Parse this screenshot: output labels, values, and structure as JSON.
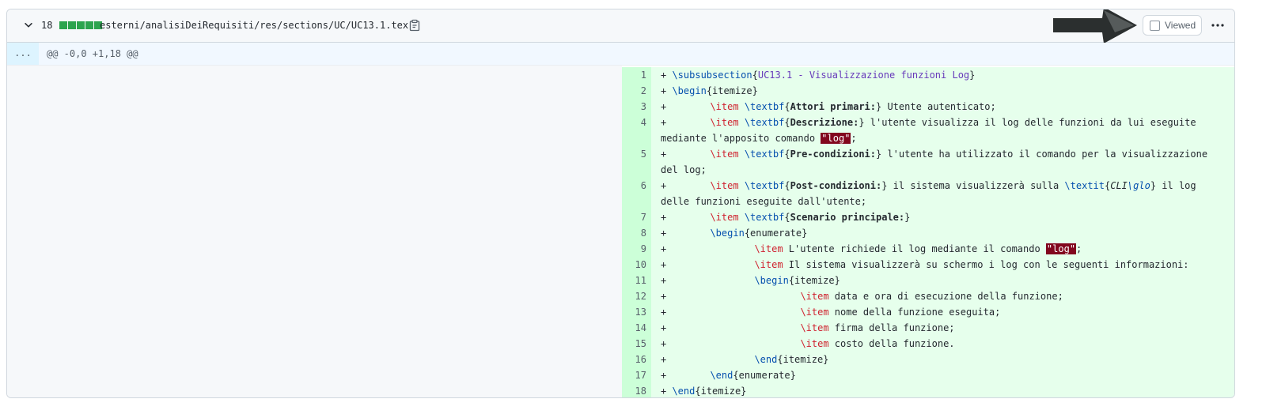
{
  "file": {
    "added_lines": "18",
    "diffstat_blocks": 5,
    "path": "esterni/analisiDeiRequisiti/res/sections/UC/UC13.1.tex",
    "viewed_label": "Viewed",
    "viewed_checked": false
  },
  "hunk": {
    "expander": "...",
    "header": "@@ -0,0 +1,18 @@"
  },
  "colors": {
    "addition_bg": "#e6ffec",
    "addition_num_bg": "#ccffd8",
    "diffstat_green": "#2da44e",
    "command_blue": "#0550ae",
    "item_red": "#cf222e",
    "error_bg": "#82071e"
  },
  "icons": [
    "chevron-down-icon",
    "copy-icon",
    "arrow-pointer-icon",
    "checkbox-icon",
    "kebab-icon"
  ],
  "lines": [
    {
      "num": "1"
    },
    {
      "num": "2"
    },
    {
      "num": "3"
    },
    {
      "num": "4"
    },
    {
      "num": "5"
    },
    {
      "num": "6"
    },
    {
      "num": "7"
    },
    {
      "num": "8"
    },
    {
      "num": "9"
    },
    {
      "num": "10"
    },
    {
      "num": "11"
    },
    {
      "num": "12"
    },
    {
      "num": "13"
    },
    {
      "num": "14"
    },
    {
      "num": "15"
    },
    {
      "num": "16"
    },
    {
      "num": "17"
    },
    {
      "num": "18"
    }
  ],
  "tokens": {
    "plus": "+ ",
    "subsubsection": "\\subsubsection",
    "l1_arg": "UC13.1 - Visualizzazione funzioni Log",
    "begin": "\\begin",
    "end": "\\end",
    "itemize": "itemize",
    "enumerate": "enumerate",
    "item": "\\item",
    "textbf": "\\textbf",
    "textit": "\\textit",
    "lb": "{",
    "rb": "}",
    "l3_bold": "Attori primari:",
    "l3_rest": " Utente autenticato;",
    "l4_bold": "Descrizione:",
    "l4_rest": " l'utente visualizza il log delle funzioni da lui eseguite mediante l'apposito comando ",
    "log_str": "\"log\"",
    "semicolon": ";",
    "l5_bold": "Pre-condizioni:",
    "l5_rest": " l'utente ha utilizzato il comando per la visualizzazione del log;",
    "l6_bold": "Post-condizioni:",
    "l6_mid": " il sistema visualizzerà sulla ",
    "l6_cli": "CLI",
    "l6_glo": "\\glo",
    "l6_rest": " il log delle funzioni eseguite dall'utente;",
    "l7_bold": "Scenario principale:",
    "l9_text": " L'utente richiede il log mediante il comando ",
    "l10_text": " Il sistema visualizzerà su schermo i log con le seguenti informazioni:",
    "l12_text": " data e ora di esecuzione della funzione;",
    "l13_text": " nome della funzione eseguita;",
    "l14_text": " firma della funzione;",
    "l15_text": " costo della funzione."
  }
}
